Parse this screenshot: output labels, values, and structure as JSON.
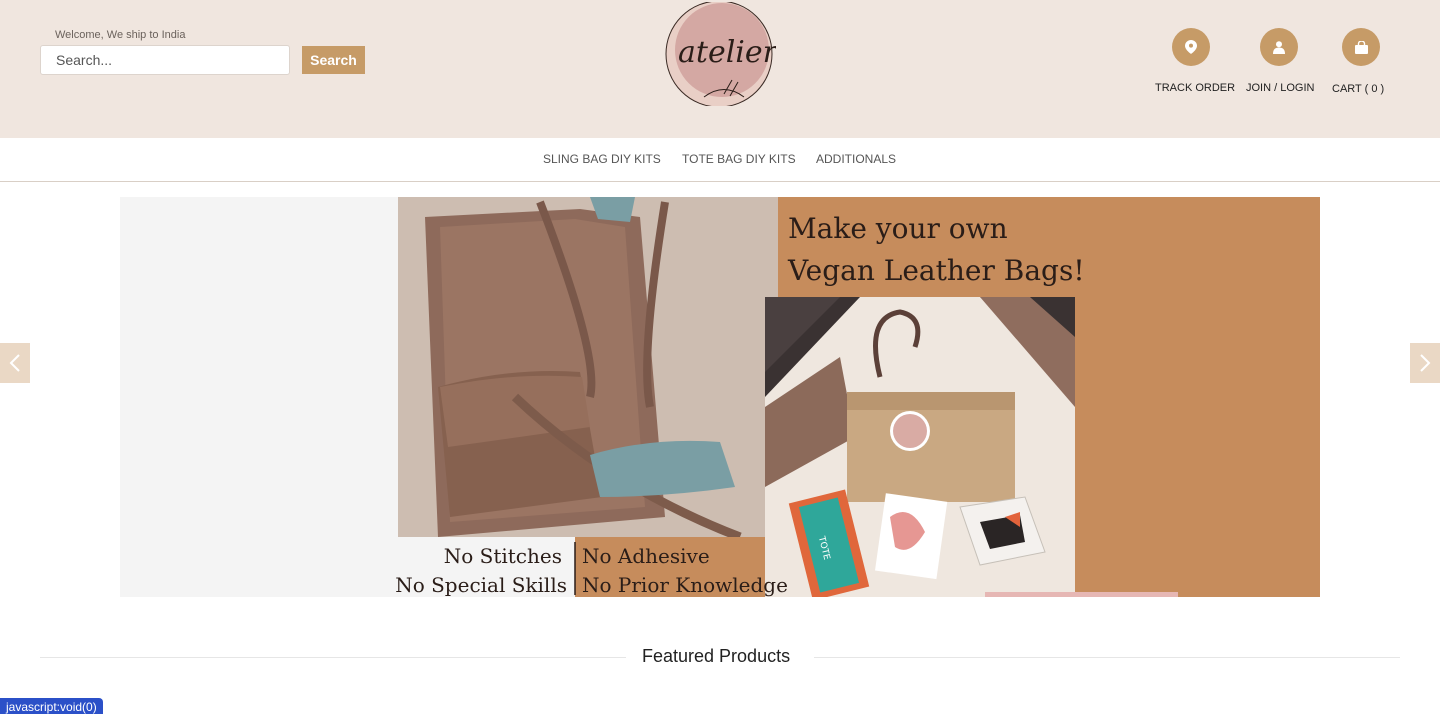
{
  "header": {
    "welcome": "Welcome, We ship to India",
    "search_placeholder": "Search...",
    "search_button": "Search",
    "logo_text": "atelier",
    "actions": {
      "track_order": "TRACK ORDER",
      "join_login": "JOIN / LOGIN",
      "cart": "CART ( 0 )"
    }
  },
  "nav": {
    "items": [
      "SLING BAG DIY KITS",
      "TOTE BAG DIY KITS",
      "ADDITIONALS"
    ]
  },
  "banner": {
    "headline_1": "Make your own",
    "headline_2": "Vegan Leather Bags!",
    "feature_1": "No Stitches",
    "feature_2": "No Adhesive",
    "feature_3": "No Special Skills",
    "feature_4": "No Prior Knowledge",
    "kit_label": "TOTE"
  },
  "featured": {
    "title": "Featured Products"
  },
  "status_bar": "javascript:void(0)",
  "colors": {
    "header_bg": "#f0e6df",
    "accent": "#c69b67",
    "banner_orange": "#c68c5c"
  },
  "icons": [
    "location-pin-icon",
    "user-icon",
    "shopping-bag-icon",
    "chevron-left-icon",
    "chevron-right-icon"
  ]
}
